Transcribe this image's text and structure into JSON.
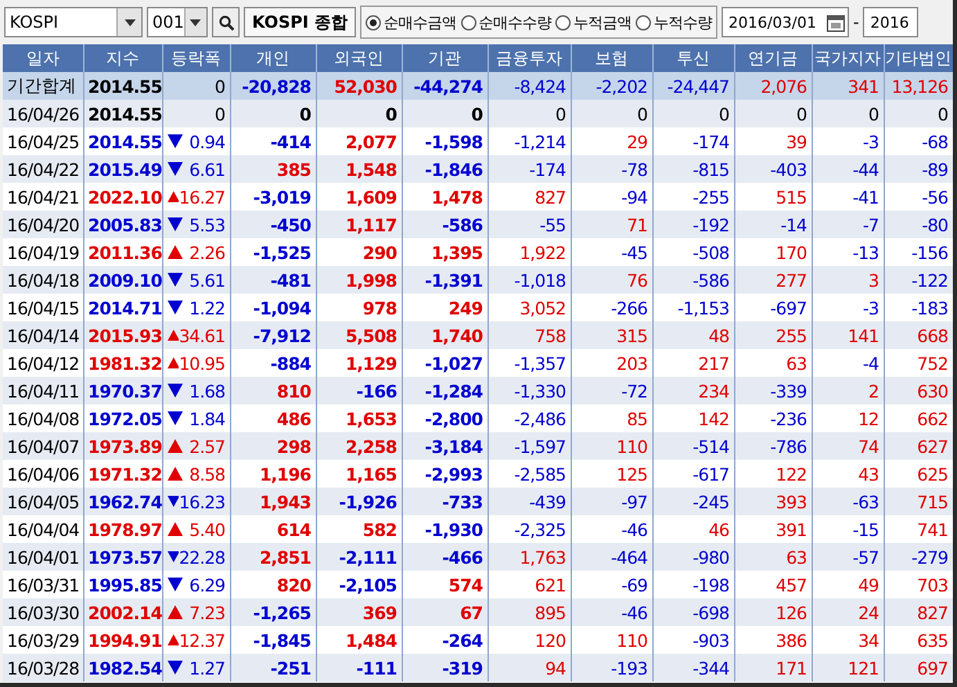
{
  "toolbar": {
    "market": "KOSPI",
    "code": "001",
    "market_name": "KOSPI 종합",
    "modes": [
      {
        "label": "순매수금액",
        "selected": true
      },
      {
        "label": "순매수수량",
        "selected": false
      },
      {
        "label": "누적금액",
        "selected": false
      },
      {
        "label": "누적수량",
        "selected": false
      }
    ],
    "date_from": "2016/03/01",
    "separator": "-",
    "date_to": "2016"
  },
  "table": {
    "columns": [
      "일자",
      "지수",
      "등락폭",
      "개인",
      "외국인",
      "기관",
      "금융투자",
      "보험",
      "투신",
      "연기금",
      "국가지자",
      "기타법인"
    ],
    "rows": [
      {
        "kind": "total",
        "date": "기간합계",
        "index": "2014.55",
        "up": false,
        "down": false,
        "change": "0",
        "values": [
          {
            "text": "-20,828",
            "color": "#0000d0"
          },
          {
            "text": "52,030",
            "color": "#e00000"
          },
          {
            "text": "-44,274",
            "color": "#0000d0"
          },
          {
            "text": "-8,424",
            "color": "#0000d0"
          },
          {
            "text": "-2,202",
            "color": "#0000d0"
          },
          {
            "text": "-24,447",
            "color": "#0000d0"
          },
          {
            "text": "2,076",
            "color": "#e00000"
          },
          {
            "text": "341",
            "color": "#e00000"
          },
          {
            "text": "13,126",
            "color": "#e00000"
          }
        ]
      },
      {
        "kind": "day",
        "date": "16/04/26",
        "index": "2014.55",
        "up": false,
        "down": false,
        "change": "0",
        "values": [
          {
            "text": "0",
            "color": "#000000"
          },
          {
            "text": "0",
            "color": "#000000"
          },
          {
            "text": "0",
            "color": "#000000"
          },
          {
            "text": "0",
            "color": "#000000"
          },
          {
            "text": "0",
            "color": "#000000"
          },
          {
            "text": "0",
            "color": "#000000"
          },
          {
            "text": "0",
            "color": "#000000"
          },
          {
            "text": "0",
            "color": "#000000"
          },
          {
            "text": "0",
            "color": "#000000"
          }
        ]
      },
      {
        "kind": "day",
        "date": "16/04/25",
        "index": "2014.55",
        "up": false,
        "down": true,
        "change": "0.94",
        "values": [
          {
            "text": "-414",
            "color": "#0000d0"
          },
          {
            "text": "2,077",
            "color": "#e00000"
          },
          {
            "text": "-1,598",
            "color": "#0000d0"
          },
          {
            "text": "-1,214",
            "color": "#0000d0"
          },
          {
            "text": "29",
            "color": "#e00000"
          },
          {
            "text": "-174",
            "color": "#0000d0"
          },
          {
            "text": "39",
            "color": "#e00000"
          },
          {
            "text": "-3",
            "color": "#0000d0"
          },
          {
            "text": "-68",
            "color": "#0000d0"
          }
        ]
      },
      {
        "kind": "day",
        "date": "16/04/22",
        "index": "2015.49",
        "up": false,
        "down": true,
        "change": "6.61",
        "values": [
          {
            "text": "385",
            "color": "#e00000"
          },
          {
            "text": "1,548",
            "color": "#e00000"
          },
          {
            "text": "-1,846",
            "color": "#0000d0"
          },
          {
            "text": "-174",
            "color": "#0000d0"
          },
          {
            "text": "-78",
            "color": "#0000d0"
          },
          {
            "text": "-815",
            "color": "#0000d0"
          },
          {
            "text": "-403",
            "color": "#0000d0"
          },
          {
            "text": "-44",
            "color": "#0000d0"
          },
          {
            "text": "-89",
            "color": "#0000d0"
          }
        ]
      },
      {
        "kind": "day",
        "date": "16/04/21",
        "index": "2022.10",
        "up": true,
        "down": false,
        "change": "16.27",
        "values": [
          {
            "text": "-3,019",
            "color": "#0000d0"
          },
          {
            "text": "1,609",
            "color": "#e00000"
          },
          {
            "text": "1,478",
            "color": "#e00000"
          },
          {
            "text": "827",
            "color": "#e00000"
          },
          {
            "text": "-94",
            "color": "#0000d0"
          },
          {
            "text": "-255",
            "color": "#0000d0"
          },
          {
            "text": "515",
            "color": "#e00000"
          },
          {
            "text": "-41",
            "color": "#0000d0"
          },
          {
            "text": "-56",
            "color": "#0000d0"
          }
        ]
      },
      {
        "kind": "day",
        "date": "16/04/20",
        "index": "2005.83",
        "up": false,
        "down": true,
        "change": "5.53",
        "values": [
          {
            "text": "-450",
            "color": "#0000d0"
          },
          {
            "text": "1,117",
            "color": "#e00000"
          },
          {
            "text": "-586",
            "color": "#0000d0"
          },
          {
            "text": "-55",
            "color": "#0000d0"
          },
          {
            "text": "71",
            "color": "#e00000"
          },
          {
            "text": "-192",
            "color": "#0000d0"
          },
          {
            "text": "-14",
            "color": "#0000d0"
          },
          {
            "text": "-7",
            "color": "#0000d0"
          },
          {
            "text": "-80",
            "color": "#0000d0"
          }
        ]
      },
      {
        "kind": "day",
        "date": "16/04/19",
        "index": "2011.36",
        "up": true,
        "down": false,
        "change": "2.26",
        "values": [
          {
            "text": "-1,525",
            "color": "#0000d0"
          },
          {
            "text": "290",
            "color": "#e00000"
          },
          {
            "text": "1,395",
            "color": "#e00000"
          },
          {
            "text": "1,922",
            "color": "#e00000"
          },
          {
            "text": "-45",
            "color": "#0000d0"
          },
          {
            "text": "-508",
            "color": "#0000d0"
          },
          {
            "text": "170",
            "color": "#e00000"
          },
          {
            "text": "-13",
            "color": "#0000d0"
          },
          {
            "text": "-156",
            "color": "#0000d0"
          }
        ]
      },
      {
        "kind": "day",
        "date": "16/04/18",
        "index": "2009.10",
        "up": false,
        "down": true,
        "change": "5.61",
        "values": [
          {
            "text": "-481",
            "color": "#0000d0"
          },
          {
            "text": "1,998",
            "color": "#e00000"
          },
          {
            "text": "-1,391",
            "color": "#0000d0"
          },
          {
            "text": "-1,018",
            "color": "#0000d0"
          },
          {
            "text": "76",
            "color": "#e00000"
          },
          {
            "text": "-586",
            "color": "#0000d0"
          },
          {
            "text": "277",
            "color": "#e00000"
          },
          {
            "text": "3",
            "color": "#e00000"
          },
          {
            "text": "-122",
            "color": "#0000d0"
          }
        ]
      },
      {
        "kind": "day",
        "date": "16/04/15",
        "index": "2014.71",
        "up": false,
        "down": true,
        "change": "1.22",
        "values": [
          {
            "text": "-1,094",
            "color": "#0000d0"
          },
          {
            "text": "978",
            "color": "#e00000"
          },
          {
            "text": "249",
            "color": "#e00000"
          },
          {
            "text": "3,052",
            "color": "#e00000"
          },
          {
            "text": "-266",
            "color": "#0000d0"
          },
          {
            "text": "-1,153",
            "color": "#0000d0"
          },
          {
            "text": "-697",
            "color": "#0000d0"
          },
          {
            "text": "-3",
            "color": "#0000d0"
          },
          {
            "text": "-183",
            "color": "#0000d0"
          }
        ]
      },
      {
        "kind": "day",
        "date": "16/04/14",
        "index": "2015.93",
        "up": true,
        "down": false,
        "change": "34.61",
        "values": [
          {
            "text": "-7,912",
            "color": "#0000d0"
          },
          {
            "text": "5,508",
            "color": "#e00000"
          },
          {
            "text": "1,740",
            "color": "#e00000"
          },
          {
            "text": "758",
            "color": "#e00000"
          },
          {
            "text": "315",
            "color": "#e00000"
          },
          {
            "text": "48",
            "color": "#e00000"
          },
          {
            "text": "255",
            "color": "#e00000"
          },
          {
            "text": "141",
            "color": "#e00000"
          },
          {
            "text": "668",
            "color": "#e00000"
          }
        ]
      },
      {
        "kind": "day",
        "date": "16/04/12",
        "index": "1981.32",
        "up": true,
        "down": false,
        "change": "10.95",
        "values": [
          {
            "text": "-884",
            "color": "#0000d0"
          },
          {
            "text": "1,129",
            "color": "#e00000"
          },
          {
            "text": "-1,027",
            "color": "#0000d0"
          },
          {
            "text": "-1,357",
            "color": "#0000d0"
          },
          {
            "text": "203",
            "color": "#e00000"
          },
          {
            "text": "217",
            "color": "#e00000"
          },
          {
            "text": "63",
            "color": "#e00000"
          },
          {
            "text": "-4",
            "color": "#0000d0"
          },
          {
            "text": "752",
            "color": "#e00000"
          }
        ]
      },
      {
        "kind": "day",
        "date": "16/04/11",
        "index": "1970.37",
        "up": false,
        "down": true,
        "change": "1.68",
        "values": [
          {
            "text": "810",
            "color": "#e00000"
          },
          {
            "text": "-166",
            "color": "#0000d0"
          },
          {
            "text": "-1,284",
            "color": "#0000d0"
          },
          {
            "text": "-1,330",
            "color": "#0000d0"
          },
          {
            "text": "-72",
            "color": "#0000d0"
          },
          {
            "text": "234",
            "color": "#e00000"
          },
          {
            "text": "-339",
            "color": "#0000d0"
          },
          {
            "text": "2",
            "color": "#e00000"
          },
          {
            "text": "630",
            "color": "#e00000"
          }
        ]
      },
      {
        "kind": "day",
        "date": "16/04/08",
        "index": "1972.05",
        "up": false,
        "down": true,
        "change": "1.84",
        "values": [
          {
            "text": "486",
            "color": "#e00000"
          },
          {
            "text": "1,653",
            "color": "#e00000"
          },
          {
            "text": "-2,800",
            "color": "#0000d0"
          },
          {
            "text": "-2,486",
            "color": "#0000d0"
          },
          {
            "text": "85",
            "color": "#e00000"
          },
          {
            "text": "142",
            "color": "#e00000"
          },
          {
            "text": "-236",
            "color": "#0000d0"
          },
          {
            "text": "12",
            "color": "#e00000"
          },
          {
            "text": "662",
            "color": "#e00000"
          }
        ]
      },
      {
        "kind": "day",
        "date": "16/04/07",
        "index": "1973.89",
        "up": true,
        "down": false,
        "change": "2.57",
        "values": [
          {
            "text": "298",
            "color": "#e00000"
          },
          {
            "text": "2,258",
            "color": "#e00000"
          },
          {
            "text": "-3,184",
            "color": "#0000d0"
          },
          {
            "text": "-1,597",
            "color": "#0000d0"
          },
          {
            "text": "110",
            "color": "#e00000"
          },
          {
            "text": "-514",
            "color": "#0000d0"
          },
          {
            "text": "-786",
            "color": "#0000d0"
          },
          {
            "text": "74",
            "color": "#e00000"
          },
          {
            "text": "627",
            "color": "#e00000"
          }
        ]
      },
      {
        "kind": "day",
        "date": "16/04/06",
        "index": "1971.32",
        "up": true,
        "down": false,
        "change": "8.58",
        "values": [
          {
            "text": "1,196",
            "color": "#e00000"
          },
          {
            "text": "1,165",
            "color": "#e00000"
          },
          {
            "text": "-2,993",
            "color": "#0000d0"
          },
          {
            "text": "-2,585",
            "color": "#0000d0"
          },
          {
            "text": "125",
            "color": "#e00000"
          },
          {
            "text": "-617",
            "color": "#0000d0"
          },
          {
            "text": "122",
            "color": "#e00000"
          },
          {
            "text": "43",
            "color": "#e00000"
          },
          {
            "text": "625",
            "color": "#e00000"
          }
        ]
      },
      {
        "kind": "day",
        "date": "16/04/05",
        "index": "1962.74",
        "up": false,
        "down": true,
        "change": "16.23",
        "values": [
          {
            "text": "1,943",
            "color": "#e00000"
          },
          {
            "text": "-1,926",
            "color": "#0000d0"
          },
          {
            "text": "-733",
            "color": "#0000d0"
          },
          {
            "text": "-439",
            "color": "#0000d0"
          },
          {
            "text": "-97",
            "color": "#0000d0"
          },
          {
            "text": "-245",
            "color": "#0000d0"
          },
          {
            "text": "393",
            "color": "#e00000"
          },
          {
            "text": "-63",
            "color": "#0000d0"
          },
          {
            "text": "715",
            "color": "#e00000"
          }
        ]
      },
      {
        "kind": "day",
        "date": "16/04/04",
        "index": "1978.97",
        "up": true,
        "down": false,
        "change": "5.40",
        "values": [
          {
            "text": "614",
            "color": "#e00000"
          },
          {
            "text": "582",
            "color": "#e00000"
          },
          {
            "text": "-1,930",
            "color": "#0000d0"
          },
          {
            "text": "-2,325",
            "color": "#0000d0"
          },
          {
            "text": "-46",
            "color": "#0000d0"
          },
          {
            "text": "46",
            "color": "#e00000"
          },
          {
            "text": "391",
            "color": "#e00000"
          },
          {
            "text": "-15",
            "color": "#0000d0"
          },
          {
            "text": "741",
            "color": "#e00000"
          }
        ]
      },
      {
        "kind": "day",
        "date": "16/04/01",
        "index": "1973.57",
        "up": false,
        "down": true,
        "change": "22.28",
        "values": [
          {
            "text": "2,851",
            "color": "#e00000"
          },
          {
            "text": "-2,111",
            "color": "#0000d0"
          },
          {
            "text": "-466",
            "color": "#0000d0"
          },
          {
            "text": "1,763",
            "color": "#e00000"
          },
          {
            "text": "-464",
            "color": "#0000d0"
          },
          {
            "text": "-980",
            "color": "#0000d0"
          },
          {
            "text": "63",
            "color": "#e00000"
          },
          {
            "text": "-57",
            "color": "#0000d0"
          },
          {
            "text": "-279",
            "color": "#0000d0"
          }
        ]
      },
      {
        "kind": "day",
        "date": "16/03/31",
        "index": "1995.85",
        "up": false,
        "down": true,
        "change": "6.29",
        "values": [
          {
            "text": "820",
            "color": "#e00000"
          },
          {
            "text": "-2,105",
            "color": "#0000d0"
          },
          {
            "text": "574",
            "color": "#e00000"
          },
          {
            "text": "621",
            "color": "#e00000"
          },
          {
            "text": "-69",
            "color": "#0000d0"
          },
          {
            "text": "-198",
            "color": "#0000d0"
          },
          {
            "text": "457",
            "color": "#e00000"
          },
          {
            "text": "49",
            "color": "#e00000"
          },
          {
            "text": "703",
            "color": "#e00000"
          }
        ]
      },
      {
        "kind": "day",
        "date": "16/03/30",
        "index": "2002.14",
        "up": true,
        "down": false,
        "change": "7.23",
        "values": [
          {
            "text": "-1,265",
            "color": "#0000d0"
          },
          {
            "text": "369",
            "color": "#e00000"
          },
          {
            "text": "67",
            "color": "#e00000"
          },
          {
            "text": "895",
            "color": "#e00000"
          },
          {
            "text": "-46",
            "color": "#0000d0"
          },
          {
            "text": "-698",
            "color": "#0000d0"
          },
          {
            "text": "126",
            "color": "#e00000"
          },
          {
            "text": "24",
            "color": "#e00000"
          },
          {
            "text": "827",
            "color": "#e00000"
          }
        ]
      },
      {
        "kind": "day",
        "date": "16/03/29",
        "index": "1994.91",
        "up": true,
        "down": false,
        "change": "12.37",
        "values": [
          {
            "text": "-1,845",
            "color": "#0000d0"
          },
          {
            "text": "1,484",
            "color": "#e00000"
          },
          {
            "text": "-264",
            "color": "#0000d0"
          },
          {
            "text": "120",
            "color": "#e00000"
          },
          {
            "text": "110",
            "color": "#e00000"
          },
          {
            "text": "-903",
            "color": "#0000d0"
          },
          {
            "text": "386",
            "color": "#e00000"
          },
          {
            "text": "34",
            "color": "#e00000"
          },
          {
            "text": "635",
            "color": "#e00000"
          }
        ]
      },
      {
        "kind": "day",
        "date": "16/03/28",
        "index": "1982.54",
        "up": false,
        "down": true,
        "change": "1.27",
        "values": [
          {
            "text": "-251",
            "color": "#0000d0"
          },
          {
            "text": "-111",
            "color": "#0000d0"
          },
          {
            "text": "-319",
            "color": "#0000d0"
          },
          {
            "text": "94",
            "color": "#e00000"
          },
          {
            "text": "-193",
            "color": "#0000d0"
          },
          {
            "text": "-344",
            "color": "#0000d0"
          },
          {
            "text": "171",
            "color": "#e00000"
          },
          {
            "text": "121",
            "color": "#e00000"
          },
          {
            "text": "697",
            "color": "#e00000"
          }
        ]
      }
    ]
  }
}
